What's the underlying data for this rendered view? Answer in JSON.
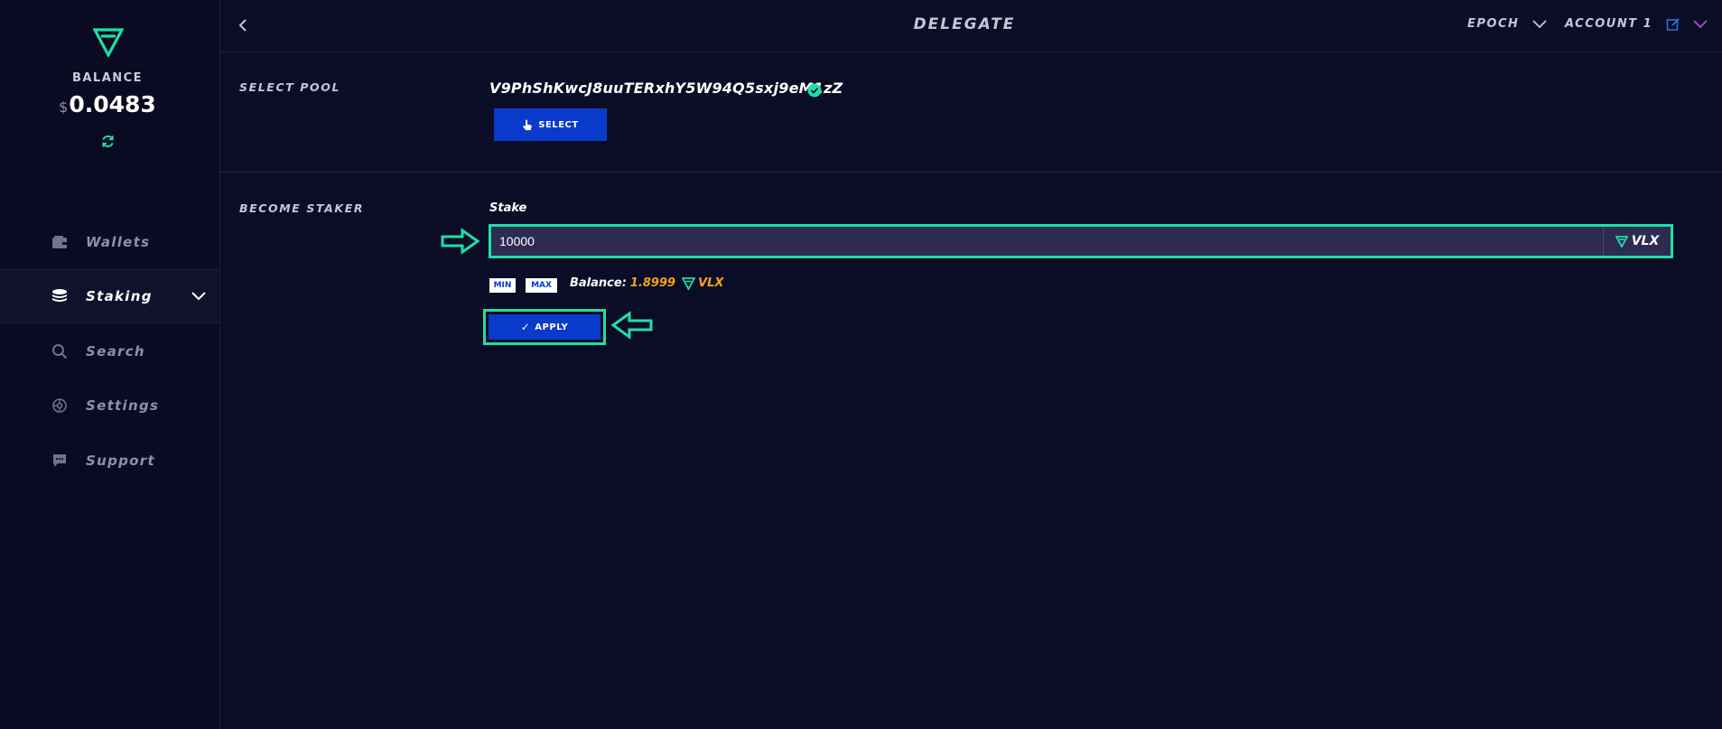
{
  "sidebar": {
    "balance_label": "BALANCE",
    "currency_symbol": "$",
    "balance_value": "0.0483",
    "nav": [
      {
        "label": "Wallets",
        "icon": "wallet-icon",
        "active": false
      },
      {
        "label": "Staking",
        "icon": "coins-stack-icon",
        "active": true
      },
      {
        "label": "Search",
        "icon": "search-icon",
        "active": false
      },
      {
        "label": "Settings",
        "icon": "settings-icon",
        "active": false
      },
      {
        "label": "Support",
        "icon": "chat-bubble-icon",
        "active": false
      }
    ]
  },
  "header": {
    "title": "DELEGATE",
    "epoch_label": "EPOCH",
    "account_label": "ACCOUNT 1"
  },
  "select_pool": {
    "label": "SELECT POOL",
    "pool_address": "V9PhShKwcJ8uuTERxhY5W94Q5sxj9eM1zZ",
    "select_button": "SELECT"
  },
  "become_staker": {
    "label": "BECOME STAKER",
    "stake_label": "Stake",
    "stake_value": "10000",
    "stake_unit": "VLX",
    "min_label": "MIN",
    "max_label": "MAX",
    "balance_label": "Balance:",
    "balance_amount": "1.8999",
    "balance_unit": "VLX",
    "apply_button": "APPLY"
  },
  "colors": {
    "accent": "#1de0a5",
    "primary_button": "#0a3acb",
    "background": "#0b0c26",
    "balance_amount": "#f7a21b"
  }
}
